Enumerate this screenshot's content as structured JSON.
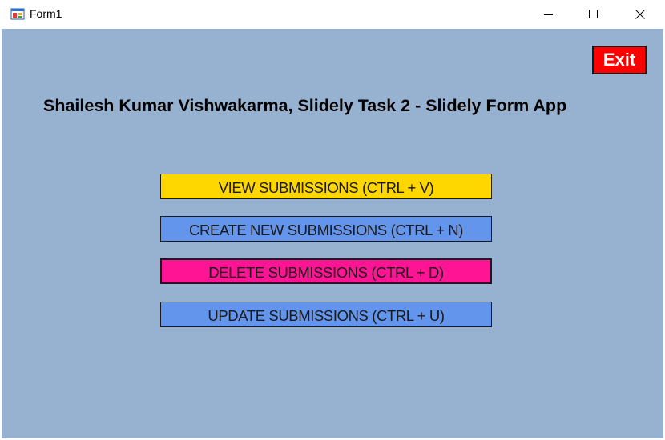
{
  "window": {
    "title": "Form1",
    "icon": "winforms-app-icon",
    "controls": {
      "minimize_icon": "minimize-icon",
      "maximize_icon": "maximize-icon",
      "close_icon": "close-icon"
    }
  },
  "form": {
    "background_color": "#97b2d0",
    "exit_label": "Exit",
    "heading": "Shailesh Kumar Vishwakarma, Slidely Task 2 - Slidely Form App",
    "buttons": [
      {
        "label": "VIEW SUBMISSIONS (CTRL + V)",
        "color": "#ffd700"
      },
      {
        "label": "CREATE NEW SUBMISSIONS (CTRL + N)",
        "color": "#6495ed"
      },
      {
        "label": "DELETE SUBMISSIONS (CTRL + D)",
        "color": "#ff1493"
      },
      {
        "label": "UPDATE SUBMISSIONS (CTRL + U)",
        "color": "#6495ed"
      }
    ],
    "exit_color": "#ff0000"
  }
}
